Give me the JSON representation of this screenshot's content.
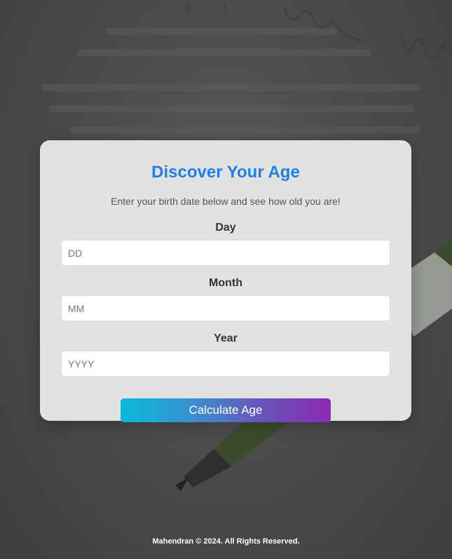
{
  "card": {
    "title": "Discover Your Age",
    "subtitle": "Enter your birth date below and see how old you are!"
  },
  "form": {
    "day": {
      "label": "Day",
      "placeholder": "DD",
      "value": ""
    },
    "month": {
      "label": "Month",
      "placeholder": "MM",
      "value": ""
    },
    "year": {
      "label": "Year",
      "placeholder": "YYYY",
      "value": ""
    },
    "submit_label": "Calculate Age"
  },
  "footer": {
    "text": "Mahendran © 2024. All Rights Reserved."
  },
  "colors": {
    "title": "#1f7fe6",
    "button_gradient_start": "#0bbad6",
    "button_gradient_end": "#8a2bb5",
    "card_background": "#e2e2e2"
  }
}
